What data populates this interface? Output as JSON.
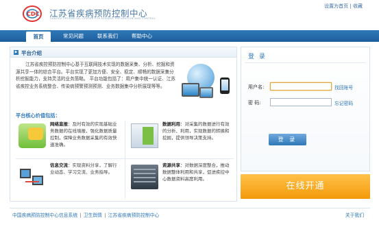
{
  "header": {
    "title": "江苏省疾病预防控制中心",
    "subtitle": "JIANGSU PROVINCIAL CENTER FOR DISEASE PREVENTION AND CONTROL",
    "links": [
      "设置为首页",
      "收藏"
    ],
    "link_sep": "|"
  },
  "nav": {
    "items": [
      "首页",
      "常见问题",
      "联系我们",
      "帮助中心"
    ]
  },
  "intro": {
    "title": "平台介绍",
    "text": "江苏省疾控预防控制中心基于互联网技术实现的数据采集、分析、挖掘和资源共享一体的综合平台。平台实现了更加方便、安全、稳定、顺畅的数据采集分析挖掘能力，支持灵活的业务策略。 平台功能包括了：用户集中统一认证、江苏省疾控业务系统整合、传染病预警预测预测、业务数据集中分析展现等等。"
  },
  "features": {
    "title": "平台核心价值包括：",
    "items": [
      {
        "name": "网络直报",
        "desc": "：及时有效的实现基础业务数据的在线填报，强化数据质量控制，保障业务数据采集的有效快速准确。",
        "icon": "chat-icon"
      },
      {
        "name": "数据利用",
        "desc": "：对采集的数据进行有效的分析、利用，实现数据的转换和挖掘，提供领导决策支持。",
        "icon": "document-icon"
      },
      {
        "name": "信息交流",
        "desc": "：实现资料分享，了解行业动态、学习交流、业务指导。",
        "icon": "network-icon"
      },
      {
        "name": "资源共享",
        "desc": "：对数据深度整合，推动数据整体利用和共享，促进疾控中心数据资料高度利用。",
        "icon": "server-icon"
      }
    ]
  },
  "login": {
    "title": "登 录",
    "username_label": "用户名:",
    "password_label": "密    码:",
    "username_value": "",
    "password_value": "",
    "find_account": "找回账号",
    "forgot_password": "忘记密码",
    "submit": "登 录"
  },
  "online_button": "在线开通",
  "footer": {
    "links": [
      "中国疾病预防控制中心信息系统",
      "卫生舆情",
      "江苏省疾病预防控制中心"
    ],
    "sep": "|",
    "about": "关于我们"
  }
}
